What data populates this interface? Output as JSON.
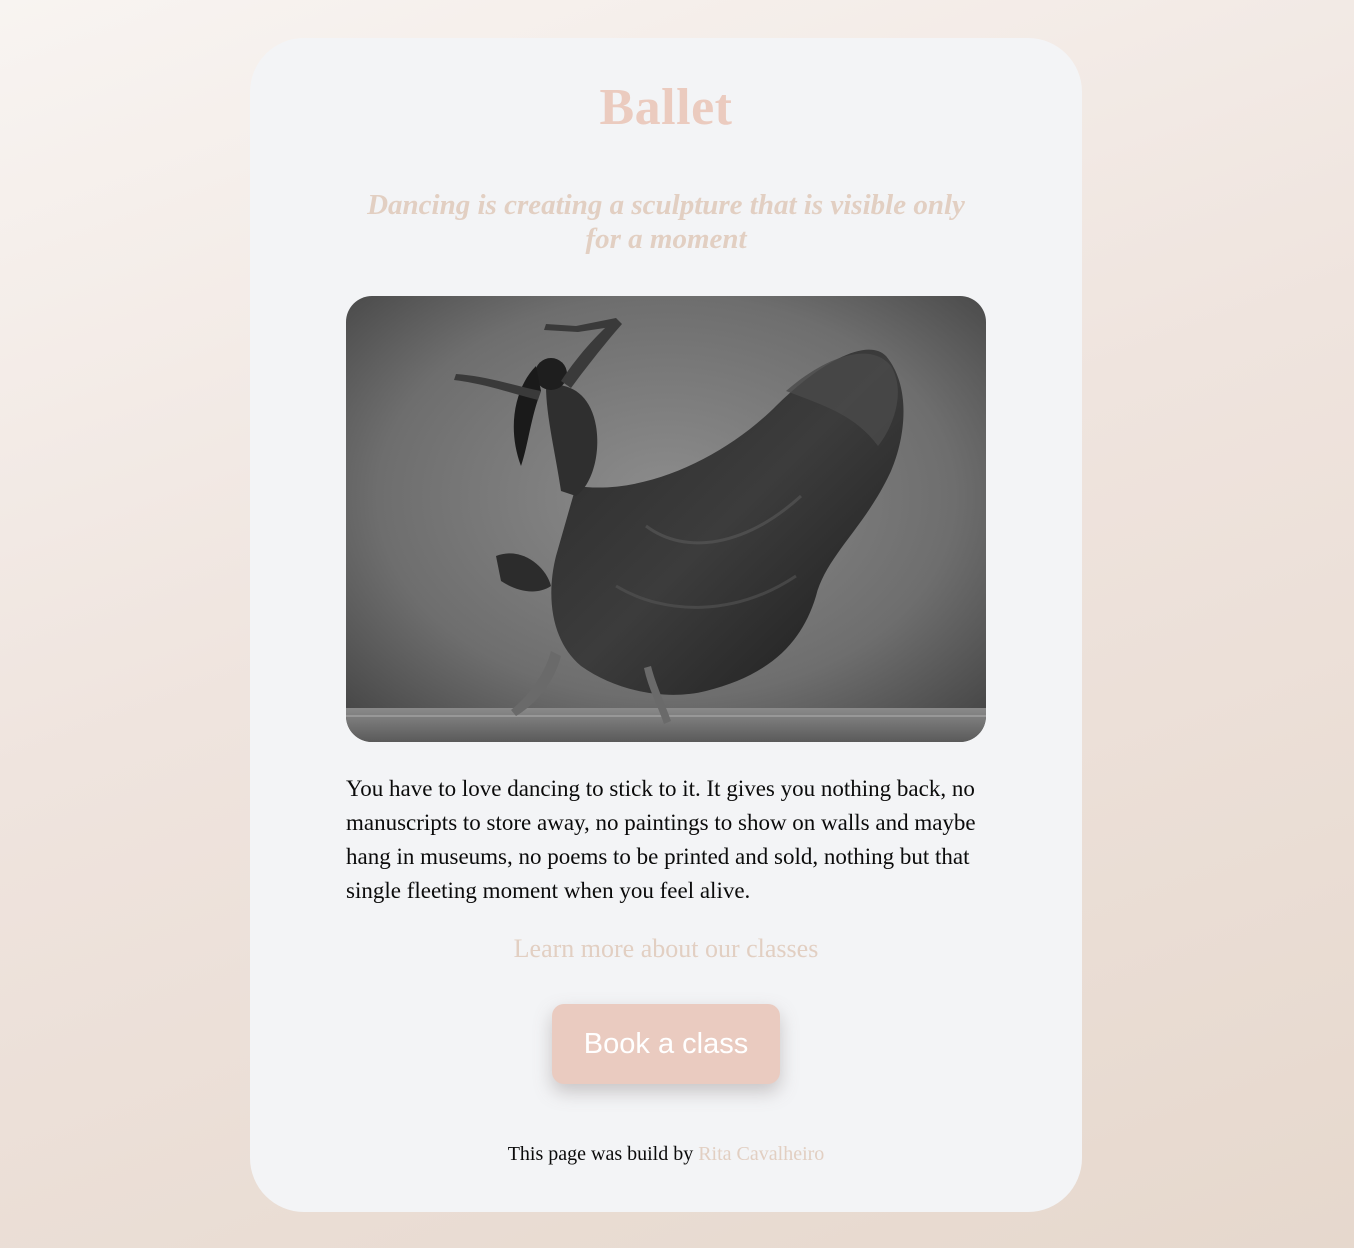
{
  "page": {
    "title": "Ballet",
    "quote": "Dancing is creating a sculpture that is visible only for a moment",
    "hero_image": {
      "description_icon": "ballet-dancer-photo"
    },
    "body": "You have to love dancing to stick to it. It gives you nothing back, no manuscripts to store away, no paintings to show on walls and maybe hang in museums, no poems to be printed and sold, nothing but that single fleeting moment when you feel alive.",
    "learn_more_link": "Learn more about our classes",
    "book_button": "Book a class",
    "footer": {
      "prefix": "This page was build by",
      "author": "Rita Cavalheiro"
    }
  },
  "colors": {
    "accent": "#ebcbbf",
    "accent_light": "#e2cfc2",
    "card_bg": "#f3f4f6",
    "text": "#0b0b0b"
  }
}
